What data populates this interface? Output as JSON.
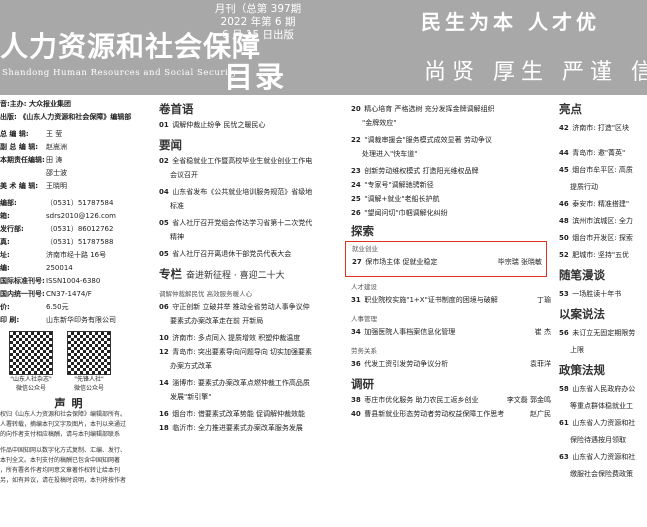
{
  "header": {
    "title_zh": "人力资源和社会保障",
    "title_en": "Shandong Human Resources and Social Security",
    "issue_line1": "月刊（总第 397期",
    "issue_line2": "2022 年第 6 期",
    "issue_line3": "6 月 15 日出版",
    "contents_title": "目录",
    "slogan1": "民生为本 人才优",
    "slogan2": "尚贤 厚生 严谨 信"
  },
  "masthead": {
    "lines": [
      "音:主办: 大众报业集团",
      "出版: 《山东人力资源和社会保障》编辑部"
    ],
    "staff": [
      {
        "label": "总 编 辑:",
        "value": "王 莹"
      },
      {
        "label": "副 总 编 辑:",
        "value": "赵嵩洲"
      },
      {
        "label": "本期责任编辑:",
        "value": "田 涛"
      },
      {
        "label": "",
        "value": "邵士波"
      },
      {
        "label": "美 术 编 辑:",
        "value": "王晓明"
      }
    ],
    "contacts": [
      {
        "label": "编部:",
        "value": "（0531）51787584"
      },
      {
        "label": "箱:",
        "value": "sdrs2010@126.com"
      },
      {
        "label": "发行部:",
        "value": "（0531）86012762"
      },
      {
        "label": "真:",
        "value": "（0531）51787588"
      },
      {
        "label": "址:",
        "value": "济南市经十路 16号"
      },
      {
        "label": "编:",
        "value": "250014"
      },
      {
        "label": "国际标准刊号:",
        "value": "ISSN1004-6380"
      },
      {
        "label": "国内统一刊号:",
        "value": "CN37-1474/F"
      },
      {
        "label": "价:",
        "value": "6.50元"
      },
      {
        "label": "印 刷:",
        "value": "山东新华印务有限公司"
      }
    ],
    "qr": [
      {
        "caption1": "\"山东人社杂志\"",
        "caption2": "微信公众号"
      },
      {
        "caption1": "\"先锋人社\"",
        "caption2": "微信公众号"
      }
    ],
    "declaration_title": "声明",
    "declaration_lines": [
      "权归《山东人力资源和社会保障》编辑部所有。",
      "人署转载，摘编本刊文字及图片，本刊以来通过",
      "的向作者支付相应稿酬，请与本刊编辑部联系",
      "",
      "作品中国知网以数字化方式复制、汇编、发行、",
      "本刊全文。本刊支付的稿酬已包含中国知网著",
      "，所有署名作者均同意文章著作权转让给本刊",
      "另，如有异议，请在投稿时说明，本刊将按作者"
    ]
  },
  "col2": {
    "sections": [
      {
        "title": "卷首语",
        "items": [
          {
            "num": "01",
            "text": "调解仲裁止纷争 民忧之暖民心",
            "cont": ""
          }
        ]
      },
      {
        "title": "要闻",
        "items": [
          {
            "num": "02",
            "text": "全省稳就业工作暨高校毕业生就业创业工作电",
            "cont": "会议召开"
          },
          {
            "num": "04",
            "text": "山东省发布《公共就业培训服务规范》省级地",
            "cont": "标准"
          },
          {
            "num": "05",
            "text": "省人社厅召开党组会传达学习省第十二次党代",
            "cont": "精神"
          },
          {
            "num": "05",
            "text": "省人社厅召开离退休干部党员代表大会",
            "cont": ""
          }
        ]
      }
    ],
    "feature_title": "专栏",
    "feature_subtitle": "奋进新征程 · 喜迎二十大",
    "feature_sub_caption": "调解仲裁解民忧 高效服务暖人心",
    "feature_items": [
      {
        "num": "06",
        "text": "守正创新 立破并举 推动全省劳动人事争议仲",
        "cont": "要素式办案改革走在前 开新局"
      },
      {
        "num": "10",
        "text": "济南市: 多点同入 提质增效 积塑仲裁温度",
        "cont": ""
      },
      {
        "num": "12",
        "text": "青岛市: 突出要素导向问题导向 切实加强要素",
        "cont": "办案方式改革"
      },
      {
        "num": "14",
        "text": "淄博市: 要素式办案改革点燃仲裁工作高品质",
        "cont": "发展\"新引擎\""
      },
      {
        "num": "16",
        "text": "烟台市: 借要素式改革势能 促调解仲裁效能",
        "cont": ""
      },
      {
        "num": "18",
        "text": "临沂市: 全力推进要素式办案改革服务发展",
        "cont": ""
      }
    ]
  },
  "col3": {
    "items_top": [
      {
        "num": "20",
        "text": "精心培育 严格选树 充分发挥金牌调解组织",
        "cont": "\"金牌效应\""
      },
      {
        "num": "22",
        "text": "\"调裁审援会\"服务模式成效显著 劳动争议",
        "cont": "处理进入\"快车道\""
      },
      {
        "num": "23",
        "text": "创新劳动维权模式 打造阳光维权品牌",
        "cont": ""
      },
      {
        "num": "24",
        "text": "\"专家号\"调解驰骋新径",
        "cont": ""
      },
      {
        "num": "25",
        "text": "\"调解+就业\"老船长护航",
        "cont": ""
      },
      {
        "num": "26",
        "text": "\"望闻问切\"巾帼调解化纠纷",
        "cont": ""
      }
    ],
    "explore_title": "探索",
    "highlight_sub": "就业创业",
    "highlight_item": {
      "num": "27",
      "text": "保市场主体 促就业稳定",
      "author": "毕宗瑞 张晓敏"
    },
    "groups": [
      {
        "sub": "人才建设",
        "items": [
          {
            "num": "31",
            "text": "职业院校实施\"1+X\"证书制度的困境与破解",
            "author": "丁瑜"
          }
        ]
      },
      {
        "sub": "人事管理",
        "items": [
          {
            "num": "34",
            "text": "加强医院人事档案信息化管理",
            "author": "崔 杰"
          }
        ]
      },
      {
        "sub": "劳务关系",
        "items": [
          {
            "num": "36",
            "text": "代发工资引发劳动争议分析",
            "author": "袁菲洋"
          }
        ]
      }
    ],
    "research_title": "调研",
    "research_items": [
      {
        "num": "38",
        "text": "枣庄市优化服务 助力农民工返乡创业",
        "author": "李文磊 郭金鸣"
      },
      {
        "num": "40",
        "text": "曹县新就业形态劳动者劳动权益保障工作思考",
        "author": "赵广民"
      }
    ]
  },
  "col4": {
    "sections": [
      {
        "title": "亮点",
        "items": [
          {
            "num": "42",
            "text": "济南市: 打造\"区块",
            "cont": ""
          },
          {
            "num": "44",
            "text": "青岛市: 邀\"菁英\"",
            "cont": ""
          },
          {
            "num": "45",
            "text": "烟台市牟平区: 高质",
            "cont": "提质行动"
          },
          {
            "num": "46",
            "text": "泰安市: 精准搭建\"",
            "cont": ""
          },
          {
            "num": "48",
            "text": "滨州市滨城区: 全力",
            "cont": ""
          },
          {
            "num": "50",
            "text": "烟台市开发区: 探索",
            "cont": ""
          },
          {
            "num": "52",
            "text": "肥城市: 坚持\"五优",
            "cont": ""
          }
        ]
      },
      {
        "title": "随笔漫谈",
        "items": [
          {
            "num": "53",
            "text": "一场胜读十年书",
            "cont": ""
          }
        ]
      },
      {
        "title": "以案说法",
        "items": [
          {
            "num": "56",
            "text": "未订立无固定期限劳",
            "cont": "上限"
          }
        ]
      },
      {
        "title": "政策法规",
        "items": [
          {
            "num": "58",
            "text": "山东省人民政府办公",
            "cont": "等重点群体稳就业工"
          },
          {
            "num": "61",
            "text": "山东省人力资源和社",
            "cont": "保险待遇按月领取"
          },
          {
            "num": "63",
            "text": "山东省人力资源和社",
            "cont": "缴服社会保险费政策"
          }
        ]
      }
    ]
  }
}
